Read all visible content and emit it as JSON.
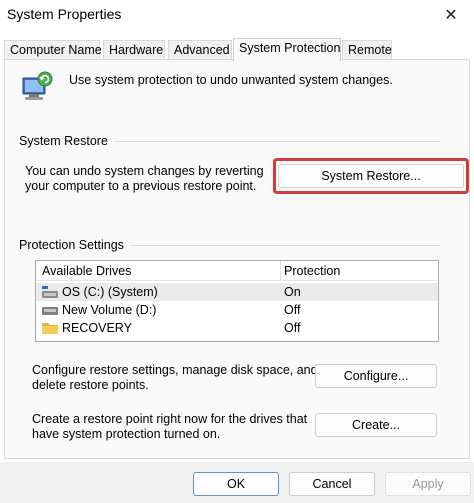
{
  "window": {
    "title": "System Properties",
    "close_glyph": "✕"
  },
  "tabs": [
    {
      "label": "Computer Name",
      "active": false
    },
    {
      "label": "Hardware",
      "active": false
    },
    {
      "label": "Advanced",
      "active": false
    },
    {
      "label": "System Protection",
      "active": true
    },
    {
      "label": "Remote",
      "active": false
    }
  ],
  "intro": {
    "icon": "system-protection-icon",
    "text": "Use system protection to undo unwanted system changes."
  },
  "system_restore": {
    "group_label": "System Restore",
    "description_line1": "You can undo system changes by reverting",
    "description_line2": "your computer to a previous restore point.",
    "button_label": "System Restore...",
    "highlight_color": "#d23a3a"
  },
  "protection": {
    "group_label": "Protection Settings",
    "columns": [
      "Available Drives",
      "Protection"
    ],
    "drives": [
      {
        "name": "OS (C:) (System)",
        "status": "On",
        "icon": "system-drive-icon",
        "selected": true
      },
      {
        "name": "New Volume (D:)",
        "status": "Off",
        "icon": "drive-icon",
        "selected": false
      },
      {
        "name": "RECOVERY",
        "status": "Off",
        "icon": "folder-icon",
        "selected": false
      }
    ],
    "configure_text_line1": "Configure restore settings, manage disk space, and",
    "configure_text_line2": "delete restore points.",
    "configure_button": "Configure...",
    "create_text_line1": "Create a restore point right now for the drives that",
    "create_text_line2": "have system protection turned on.",
    "create_button": "Create..."
  },
  "footer": {
    "ok": "OK",
    "cancel": "Cancel",
    "apply": "Apply"
  }
}
